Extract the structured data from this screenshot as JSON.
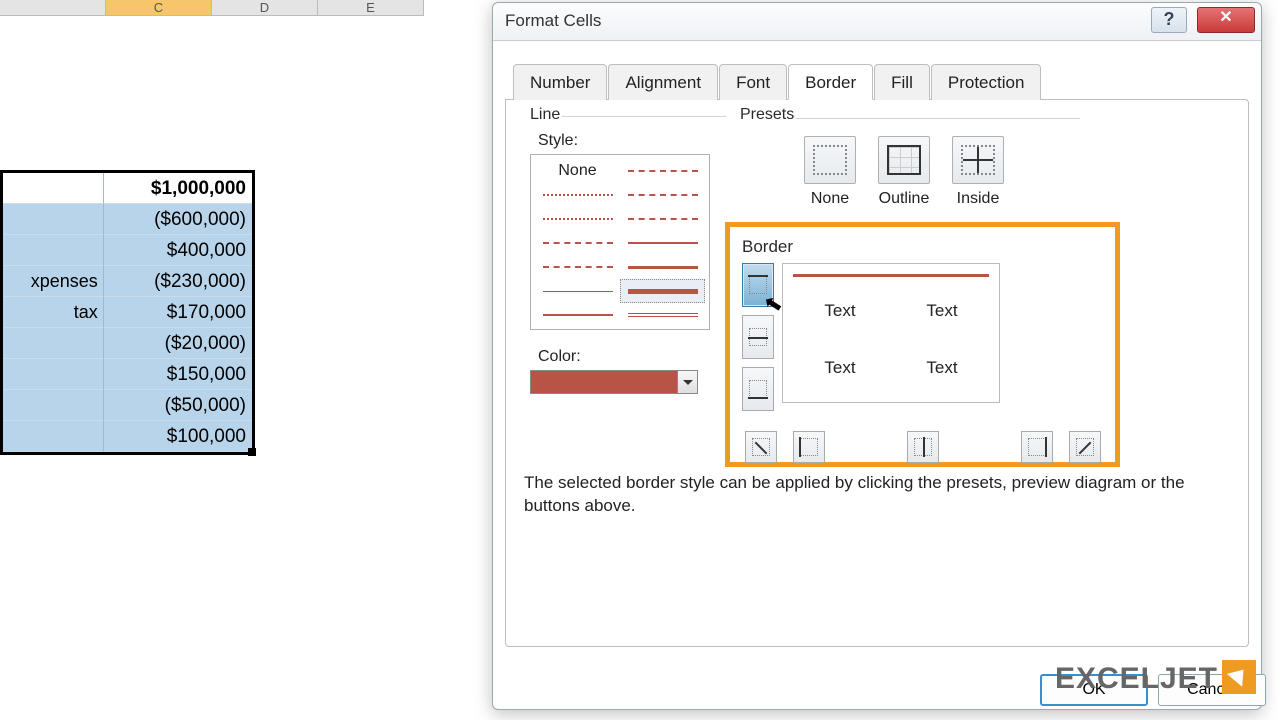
{
  "cols": [
    "",
    "C",
    "D",
    "E"
  ],
  "sheet": {
    "rows": [
      {
        "label": "",
        "value": "$1,000,000"
      },
      {
        "label": "",
        "value": "($600,000)"
      },
      {
        "label": "",
        "value": "$400,000"
      },
      {
        "label": "xpenses",
        "value": "($230,000)"
      },
      {
        "label": " tax",
        "value": "$170,000"
      },
      {
        "label": "",
        "value": "($20,000)"
      },
      {
        "label": "",
        "value": "$150,000"
      },
      {
        "label": "",
        "value": "($50,000)"
      },
      {
        "label": "",
        "value": "$100,000"
      }
    ]
  },
  "dialog": {
    "title": "Format Cells",
    "tabs": [
      "Number",
      "Alignment",
      "Font",
      "Border",
      "Fill",
      "Protection"
    ],
    "active_tab": "Border",
    "line": {
      "group": "Line",
      "style_label": "Style:",
      "none": "None",
      "color_label": "Color:",
      "color": "#B85446"
    },
    "presets": {
      "group": "Presets",
      "none": "None",
      "outline": "Outline",
      "inside": "Inside"
    },
    "border": {
      "group": "Border",
      "preview_text": "Text"
    },
    "hint": "The selected border style can be applied by clicking the presets, preview diagram or the buttons above.",
    "ok": "OK",
    "cancel": "Cancel"
  },
  "brand": {
    "part1": "EXCEL",
    "part2": "JET"
  }
}
